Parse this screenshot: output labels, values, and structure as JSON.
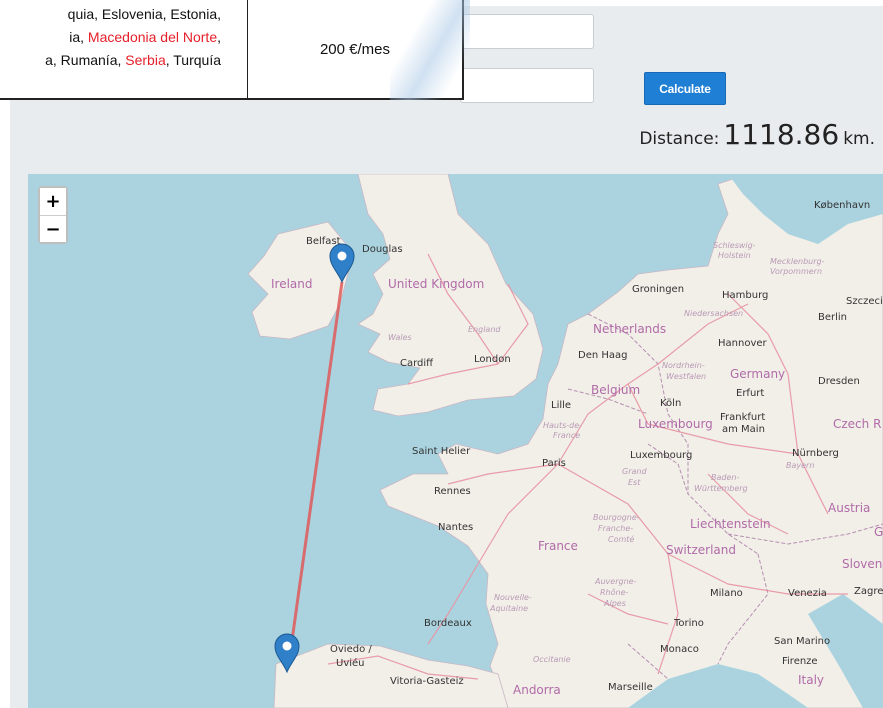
{
  "price_table": {
    "countries_line1": "quia, Eslovenia, Estonia,",
    "countries_line2_a": "ia, ",
    "countries_line2_red": "Macedonia del Norte",
    "countries_line2_b": ",",
    "countries_line3_a": "a, Rumanía, ",
    "countries_line3_red": "Serbia",
    "countries_line3_b": ", Turquía",
    "price": "200 €/mes"
  },
  "form": {
    "origin_value": "",
    "destination_value": "",
    "calculate_label": "Calculate"
  },
  "result": {
    "label": "Distance:",
    "value": "1118.86",
    "unit": "km."
  },
  "map": {
    "zoom_in": "+",
    "zoom_out": "−",
    "route_color": "#e05a5a",
    "marker_color": "#2f7fc9",
    "cities": {
      "belfast": "Belfast",
      "douglas": "Douglas",
      "kobenhavn": "København",
      "groningen": "Groningen",
      "hamburg": "Hamburg",
      "szczecin": "Szczecin",
      "berlin": "Berlin",
      "cardiff": "Cardiff",
      "london": "London",
      "den_haag": "Den Haag",
      "hannover": "Hannover",
      "erfurt": "Erfurt",
      "dresden": "Dresden",
      "lille": "Lille",
      "koln": "Köln",
      "frankfurt": "Frankfurt",
      "am_main": "am Main",
      "saint_helier": "Saint Helier",
      "paris": "Paris",
      "luxembourg_city": "Luxembourg",
      "nurnberg": "Nürnberg",
      "rennes": "Rennes",
      "nantes": "Nantes",
      "bordeaux": "Bordeaux",
      "milano": "Milano",
      "venezia": "Venezia",
      "zagreb": "Zagre",
      "torino": "Torino",
      "monaco": "Monaco",
      "san_marino": "San Marino",
      "firenze": "Firenze",
      "oviedo": "Oviedo /",
      "uvieu": "Uviéu",
      "vitoria": "Vitoria-Gasteiz",
      "marseille": "Marseille"
    },
    "countries": {
      "ireland": "Ireland",
      "uk": "United Kingdom",
      "netherlands": "Netherlands",
      "belgium": "Belgium",
      "luxembourg": "Luxembourg",
      "germany": "Germany",
      "czech": "Czech R",
      "france": "France",
      "liechtenstein": "Liechtenstein",
      "switzerland": "Switzerland",
      "austria": "Austria",
      "slovenia": "Sloven",
      "italy": "Italy",
      "andorra": "Andorra",
      "g": "G"
    },
    "regions": {
      "schleswig": "Schleswig-",
      "holstein": "Holstein",
      "mecklenburg": "Mecklenburg-",
      "vorpommern": "Vorpommern",
      "niedersachsen": "Niedersachsen",
      "wales": "Wales",
      "england": "England",
      "nordrhein": "Nordrhein-",
      "westfalen": "Westfalen",
      "hauts": "Hauts-de-",
      "hauts_france": "France",
      "grand": "Grand",
      "est": "Est",
      "baden": "Baden-",
      "wurttemberg": "Württemberg",
      "bayern": "Bayern",
      "bourgogne": "Bourgogne-",
      "franche": "Franche-",
      "comte": "Comté",
      "nouvelle": "Nouvelle-",
      "aquitaine": "Aquitaine",
      "auvergne": "Auvergne-",
      "rhone": "Rhône-",
      "alpes": "Alpes",
      "occitanie": "Occitanie"
    }
  }
}
